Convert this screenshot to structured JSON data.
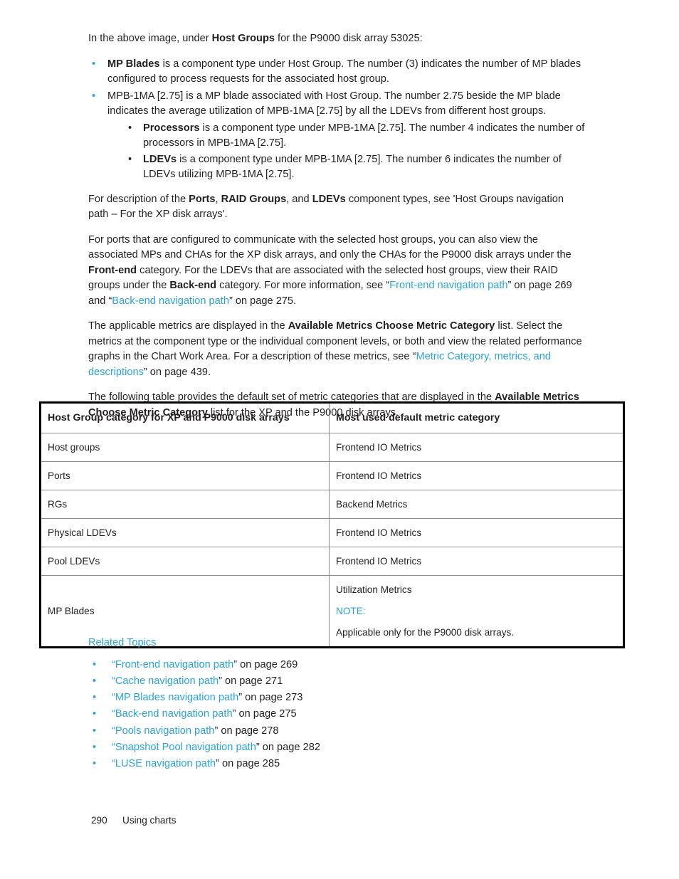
{
  "intro": {
    "lead_prefix": "In the above image, under ",
    "lead_bold": "Host Groups",
    "lead_suffix": " for the P9000 disk array 53025:"
  },
  "bullets": {
    "bullet_glyph": "•",
    "items": [
      {
        "bold": "MP Blades",
        "text": " is a component type under Host Group. The number (3) indicates the number of MP blades configured to process requests for the associated host group."
      },
      {
        "bold": "",
        "text": "MPB-1MA [2.75] is a MP blade associated with Host Group. The number 2.75 beside the MP blade indicates the average utilization of MPB-1MA [2.75] by all the LDEVs from different host groups."
      }
    ],
    "sub_items": [
      {
        "bold": "Processors",
        "text": " is a component type under MPB-1MA [2.75]. The number 4 indicates the number of processors in MPB-1MA [2.75]."
      },
      {
        "bold": "LDEVs",
        "text": " is a component type under MPB-1MA [2.75]. The number 6 indicates the number of LDEVs utilizing MPB-1MA [2.75]."
      }
    ]
  },
  "paragraphs": {
    "p_desc_1": "For description of the ",
    "p_desc_b1": "Ports",
    "p_desc_2": ", ",
    "p_desc_b2": "RAID Groups",
    "p_desc_3": ", and ",
    "p_desc_b3": "LDEVs",
    "p_desc_4": " component types, see 'Host Groups navigation path – For the XP disk arrays'.",
    "p_ports_1": "For ports that are configured to communicate with the selected host groups, you can also view the associated MPs and CHAs for the XP disk arrays, and only the CHAs for the P9000 disk arrays under the ",
    "p_ports_b1": "Front-end",
    "p_ports_2": " category. For the LDEVs that are associated with the selected host groups, view their RAID groups under the ",
    "p_ports_b2": "Back-end",
    "p_ports_3": " category. For more information, see “",
    "p_ports_link1": "Front-end navigation path",
    "p_ports_4": "” on page 269 and “",
    "p_ports_link2": "Back-end navigation path",
    "p_ports_5": "” on page 275.",
    "p_metrics_1": "The applicable metrics are displayed in the ",
    "p_metrics_b1": "Available Metrics Choose Metric Category",
    "p_metrics_2": " list. Select the metrics at the component type or the individual component levels, or both and view the related performance graphs in the Chart Work Area. For a description of these metrics, see “",
    "p_metrics_link1": "Metric Category, metrics, and descriptions",
    "p_metrics_3": "” on page 439.",
    "p_table_1": "The following table provides the default set of metric categories that are displayed in the ",
    "p_table_b1": "Available Metrics Choose Metric Category",
    "p_table_2": " list for the XP and the P9000 disk arrays."
  },
  "table": {
    "headers": [
      "Host Group category for XP and P9000 disk arrays",
      "Most used default metric category"
    ],
    "rows": [
      {
        "category": "Host groups",
        "metric": "Frontend IO Metrics"
      },
      {
        "category": "Ports",
        "metric": "Frontend IO Metrics"
      },
      {
        "category": "RGs",
        "metric": "Backend Metrics"
      },
      {
        "category": "Physical LDEVs",
        "metric": "Frontend IO Metrics"
      },
      {
        "category": "Pool LDEVs",
        "metric": "Frontend IO Metrics"
      }
    ],
    "last_row": {
      "category": "MP Blades",
      "metric": "Utilization Metrics",
      "note_label": "NOTE:",
      "note_text": "Applicable only for the P9000 disk arrays."
    }
  },
  "related_topics": {
    "title": "Related Topics",
    "bullet_glyph": "•",
    "items": [
      {
        "link": "Front-end navigation path",
        "suffix": "” on page 269",
        "prefix": "“"
      },
      {
        "link": "Cache navigation path",
        "suffix": "” on page 271",
        "prefix": "“"
      },
      {
        "link": "MP Blades navigation path",
        "suffix": "” on page 273",
        "prefix": "“"
      },
      {
        "link": "Back-end navigation path",
        "suffix": "” on page 275",
        "prefix": "“"
      },
      {
        "link": "Pools navigation path",
        "suffix": "” on page 278",
        "prefix": "“"
      },
      {
        "link": "Snapshot Pool navigation path",
        "suffix": "” on page 282",
        "prefix": "“"
      },
      {
        "link": "LUSE navigation path",
        "suffix": "” on page 285",
        "prefix": "“"
      }
    ]
  },
  "footer": {
    "page_number": "290",
    "chapter": "Using charts"
  },
  "colors": {
    "link": "#28a3dc",
    "text": "#231f20",
    "table_outer_border": "#000000",
    "table_inner_border": "#8d8d8d"
  }
}
